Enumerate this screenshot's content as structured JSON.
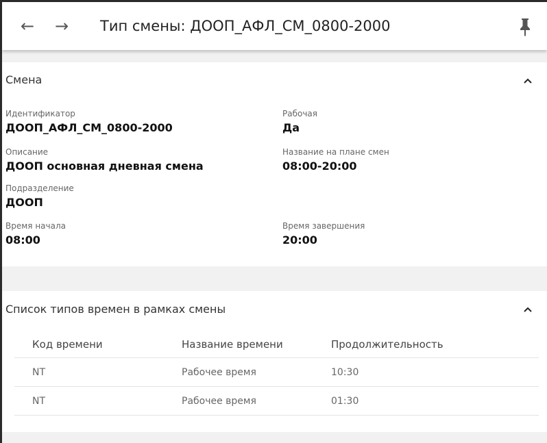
{
  "header": {
    "title": "Тип смены: ДООП_АФЛ_СМ_0800-2000",
    "back_icon": "←",
    "forward_icon": "→",
    "pin_icon": "pin-icon"
  },
  "shift_section": {
    "title": "Смена",
    "fields": {
      "identifier": {
        "label": "Идентификатор",
        "value": "ДООП_АФЛ_СМ_0800-2000"
      },
      "working": {
        "label": "Рабочая",
        "value": "Да"
      },
      "description": {
        "label": "Описание",
        "value": "ДООП основная дневная смена"
      },
      "plan_name": {
        "label": "Название на плане смен",
        "value": "08:00-20:00"
      },
      "department": {
        "label": "Подразделение",
        "value": "ДООП"
      },
      "start_time": {
        "label": "Время начала",
        "value": "08:00"
      },
      "end_time": {
        "label": "Время завершения",
        "value": "20:00"
      }
    }
  },
  "times_section": {
    "title": "Список типов времен в рамках смены",
    "columns": [
      "Код времени",
      "Название времени",
      "Продолжительность"
    ],
    "rows": [
      [
        "NT",
        "Рабочее время",
        "10:30"
      ],
      [
        "NT",
        "Рабочее время",
        "01:30"
      ]
    ]
  }
}
